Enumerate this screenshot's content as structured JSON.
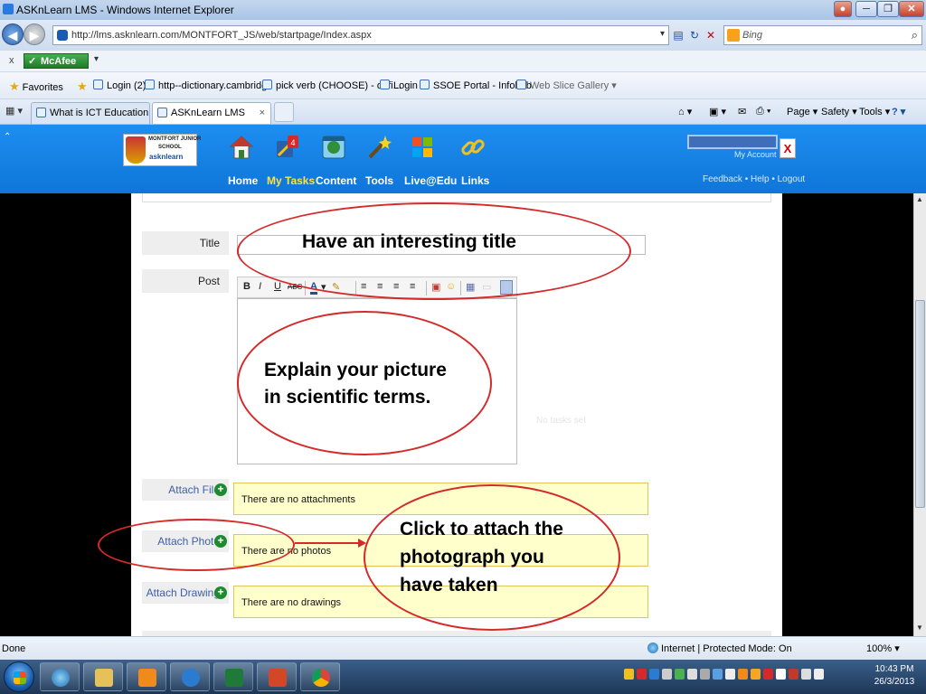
{
  "window": {
    "title": "ASKnLearn LMS - Windows Internet Explorer",
    "minimize": "─",
    "maximize": "❐",
    "close": "✕"
  },
  "addressbar": {
    "url": "http://lms.asknlearn.com/MONTFORT_JS/web/startpage/Index.aspx",
    "search_placeholder": "Bing",
    "icons": [
      "back-icon",
      "forward-icon",
      "compatibility-icon",
      "refresh-icon",
      "stop-icon",
      "search-icon"
    ]
  },
  "mcafee": {
    "close": "x",
    "label": "McAfee"
  },
  "favorites": {
    "label": "Favorites",
    "items": [
      "Login (2)",
      "http--dictionary.cambridge",
      "pick verb (CHOOSE) - defi...",
      "Login",
      "SSOE Portal - Infohub",
      "Web Slice Gallery ▾"
    ]
  },
  "tabs": {
    "items": [
      {
        "label": "What is ICT Education and ..."
      },
      {
        "label": "ASKnLearn LMS",
        "close": "×"
      }
    ],
    "commands": [
      "Page ▾",
      "Safety ▾",
      "Tools ▾"
    ]
  },
  "lms": {
    "logo_lines": [
      "MONTFORT JUNIOR",
      "SCHOOL",
      "asknlearn"
    ],
    "nav": [
      {
        "label": "Home"
      },
      {
        "label": "My Tasks",
        "badge": "4"
      },
      {
        "label": "Content"
      },
      {
        "label": "Tools"
      },
      {
        "label": "Live@Edu"
      },
      {
        "label": "Links"
      }
    ],
    "account_close": "X",
    "my_account": "My Account",
    "links": "Feedback  •  Help  •  Logout"
  },
  "form": {
    "title_label": "Title",
    "post_label": "Post",
    "toolbar": [
      "B",
      "I",
      "U",
      "ABC",
      "A"
    ],
    "attach_file": "Attach File",
    "attach_photo": "Attach Photo",
    "attach_drawing": "Attach Drawing",
    "no_attachments": "There are no attachments",
    "no_photos": "There are no photos",
    "no_drawings": "There are no drawings",
    "faint_text": "No tasks set"
  },
  "annotations": {
    "title_hint": "Have an interesting title",
    "post_hint_1": "Explain your picture",
    "post_hint_2": "in scientific terms.",
    "photo_hint_1": "Click to attach the",
    "photo_hint_2": "photograph you",
    "photo_hint_3": "have taken",
    "color": "#d62a2a"
  },
  "statusbar": {
    "status": "Done",
    "zone": "Internet | Protected Mode: On",
    "zoom": "100% ▾"
  },
  "taskbar": {
    "time": "10:43 PM",
    "date": "26/3/2013"
  }
}
